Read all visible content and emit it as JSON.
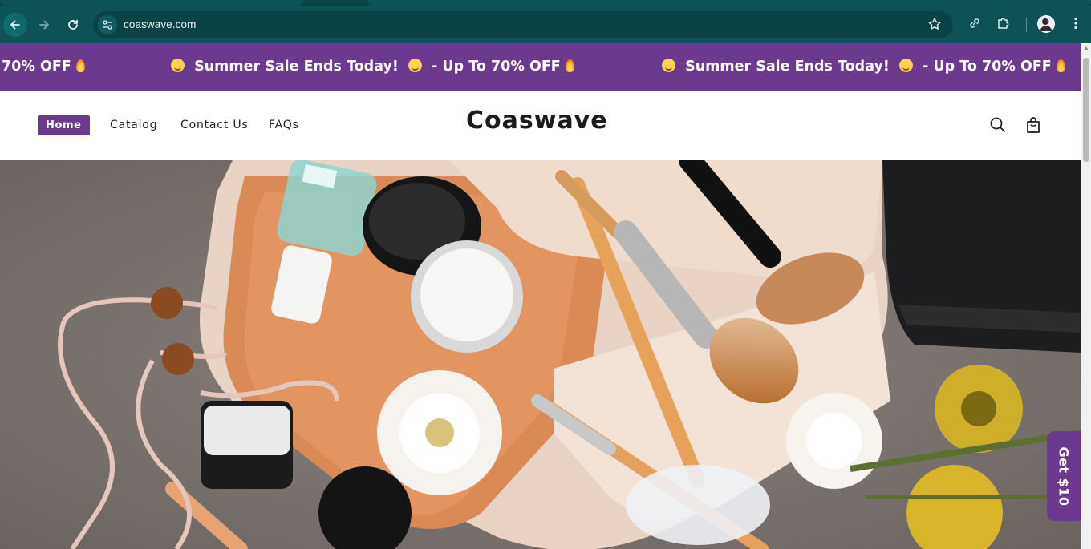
{
  "browser": {
    "url": "coaswave.com"
  },
  "announcement": {
    "partial": "70% OFF",
    "message": "Summer Sale Ends Today!",
    "discount": "- Up To 70% OFF"
  },
  "header": {
    "nav": [
      "Home",
      "Catalog",
      "Contact Us",
      "FAQs"
    ],
    "logo": "Coaswave"
  },
  "promo": {
    "tab_label": "Get $10"
  },
  "colors": {
    "brand_purple": "#6b3a8e",
    "chrome_teal": "#0d5355"
  },
  "icons": [
    "back-arrow-icon",
    "forward-arrow-icon",
    "reload-icon",
    "site-settings-icon",
    "bookmark-star-icon",
    "link-icon",
    "extensions-puzzle-icon",
    "profile-avatar-icon",
    "kebab-menu-icon",
    "search-icon",
    "shopping-bag-icon",
    "sun-emoji-icon",
    "fire-emoji-icon"
  ]
}
